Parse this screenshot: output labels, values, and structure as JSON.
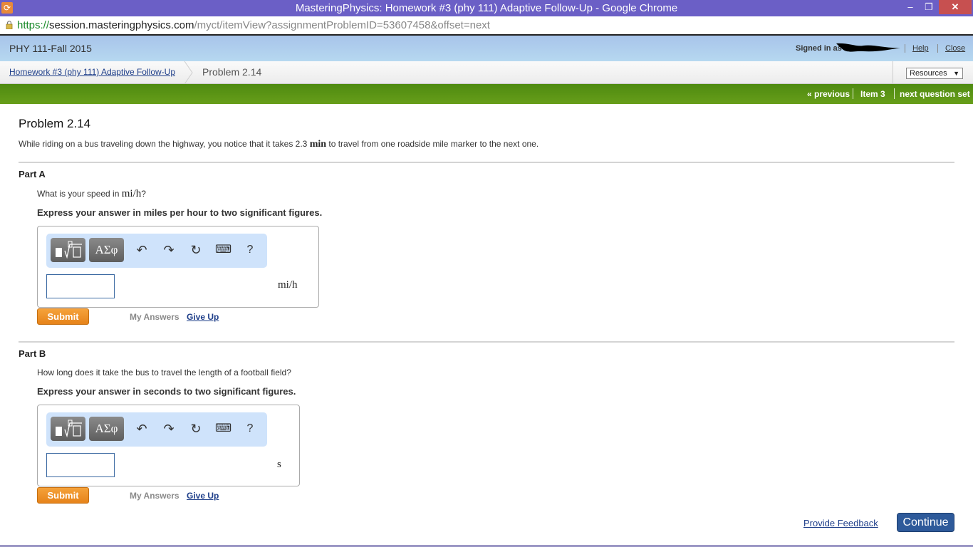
{
  "window": {
    "title": "MasteringPhysics: Homework #3 (phy 111) Adaptive Follow-Up - Google Chrome",
    "min_icon": "minimize-icon",
    "max_icon": "restore-icon",
    "close_icon": "close-icon"
  },
  "address_bar": {
    "scheme": "https://",
    "host": "session.masteringphysics.com",
    "path": "/myct/itemView?assignmentProblemID=53607458&offset=next"
  },
  "header": {
    "course": "PHY 111-Fall 2015",
    "signed_in": "Signed in as",
    "help": "Help",
    "close": "Close"
  },
  "breadcrumb": {
    "assignment": "Homework #3 (phy 111) Adaptive Follow-Up",
    "current": "Problem 2.14",
    "resources": "Resources"
  },
  "nav": {
    "previous": "« previous",
    "item": "Item 3",
    "next": "next question set"
  },
  "problem": {
    "title": "Problem 2.14",
    "intro_before": "While riding on a bus traveling down the highway, you notice that it takes 2.3 ",
    "intro_unit": "min",
    "intro_after": " to travel from one roadside mile marker to the next one."
  },
  "parts": [
    {
      "label": "Part A",
      "question_before": "What is your speed in ",
      "question_unit": "mi/h",
      "question_after": "?",
      "instruction": "Express your answer in miles per hour to two significant figures.",
      "answer_value": "",
      "unit": "mi/h",
      "toolbar": {
        "templates": "■ ∜□",
        "symbols": "ΑΣφ",
        "undo": "↶",
        "redo": "↷",
        "reset": "↻",
        "keyboard": "⌨",
        "help": "?"
      },
      "submit": "Submit",
      "my_answers": "My Answers",
      "give_up": "Give Up"
    },
    {
      "label": "Part B",
      "question": "How long does it take the bus to travel the length of a football field?",
      "instruction": "Express your answer in seconds to two significant figures.",
      "answer_value": "",
      "unit": "s",
      "toolbar": {
        "templates": "■ ∜□",
        "symbols": "ΑΣφ",
        "undo": "↶",
        "redo": "↷",
        "reset": "↻",
        "keyboard": "⌨",
        "help": "?"
      },
      "submit": "Submit",
      "my_answers": "My Answers",
      "give_up": "Give Up"
    }
  ],
  "footer": {
    "feedback": "Provide Feedback",
    "continue": "Continue"
  },
  "colors": {
    "titlebar": "#6b5fc6",
    "nav_green": "#5a9414",
    "submit_orange": "#ec8a22",
    "continue_blue": "#2e5a9a"
  }
}
